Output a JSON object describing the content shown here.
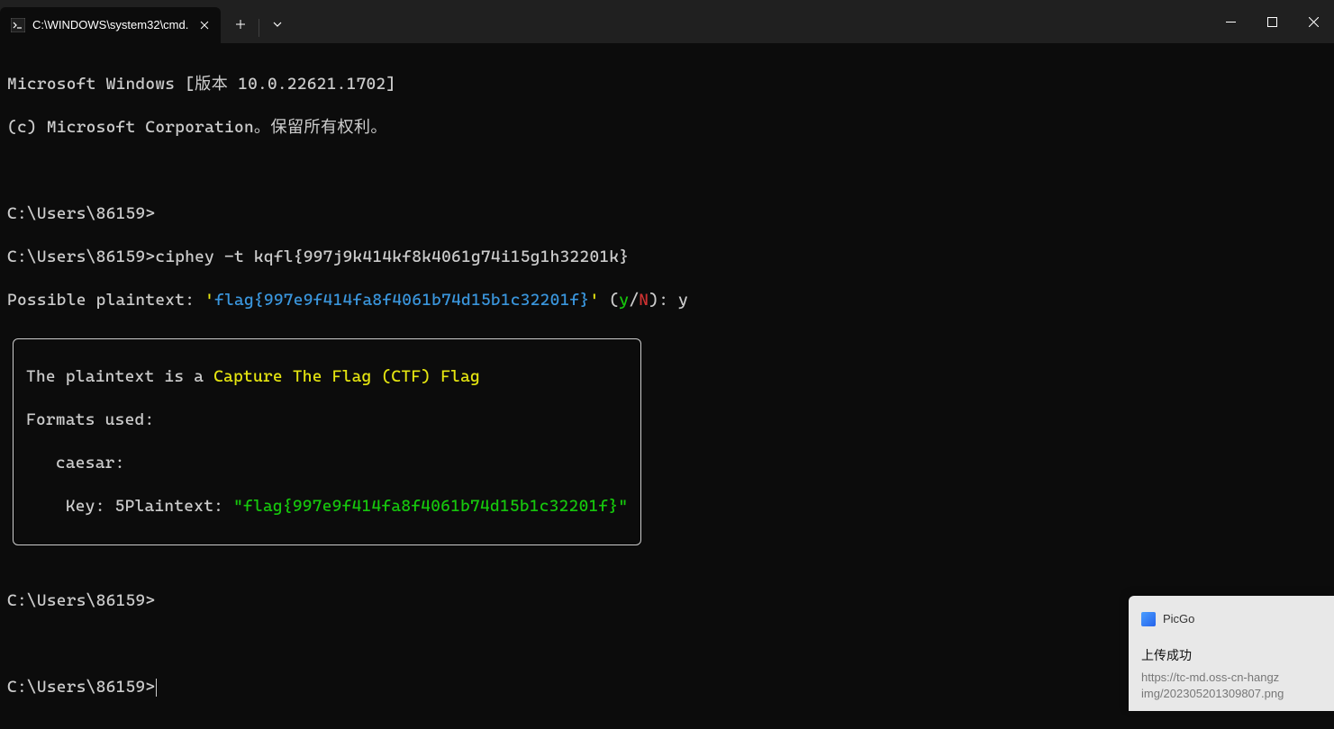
{
  "titlebar": {
    "tab_title": "C:\\WINDOWS\\system32\\cmd.",
    "tab_icon": "cmd",
    "new_tab": "+",
    "dropdown": "⌄"
  },
  "window_controls": {
    "minimize": "−",
    "maximize": "▢",
    "close": "✕"
  },
  "terminal": {
    "banner_line1": "Microsoft Windows [版本 10.0.22621.1702]",
    "banner_line2": "(c) Microsoft Corporation。保留所有权利。",
    "prompt1": "C:\\Users\\86159>",
    "prompt2_prefix": "C:\\Users\\86159>",
    "prompt2_cmd": "ciphey -t kqfl{997j9k414kf8k4061g74i15g1h32201k}",
    "possible_label": "Possible plaintext: ",
    "possible_quote_open": "'",
    "possible_value": "flag{997e9f414fa8f4061b74d15b1c32201f}",
    "possible_quote_close": "'",
    "yn_open": " (",
    "yn_y": "y",
    "yn_slash": "/",
    "yn_n": "N",
    "yn_close": "): ",
    "yn_answer": "y",
    "box_line1_prefix": "The plaintext is a ",
    "box_line1_hl": "Capture The Flag (CTF) Flag",
    "box_line2": "Formats used:",
    "box_line3": "   caesar:",
    "box_line4_prefix": "    Key: 5Plaintext: ",
    "box_line4_value": "\"flag{997e9f414fa8f4061b74d15b1c32201f}\"",
    "prompt3": "C:\\Users\\86159>",
    "prompt4": "C:\\Users\\86159>"
  },
  "toast": {
    "app": "PicGo",
    "title": "上传成功",
    "body_line1": "https://tc-md.oss-cn-hangz",
    "body_line2": "img/202305201309807.png"
  }
}
